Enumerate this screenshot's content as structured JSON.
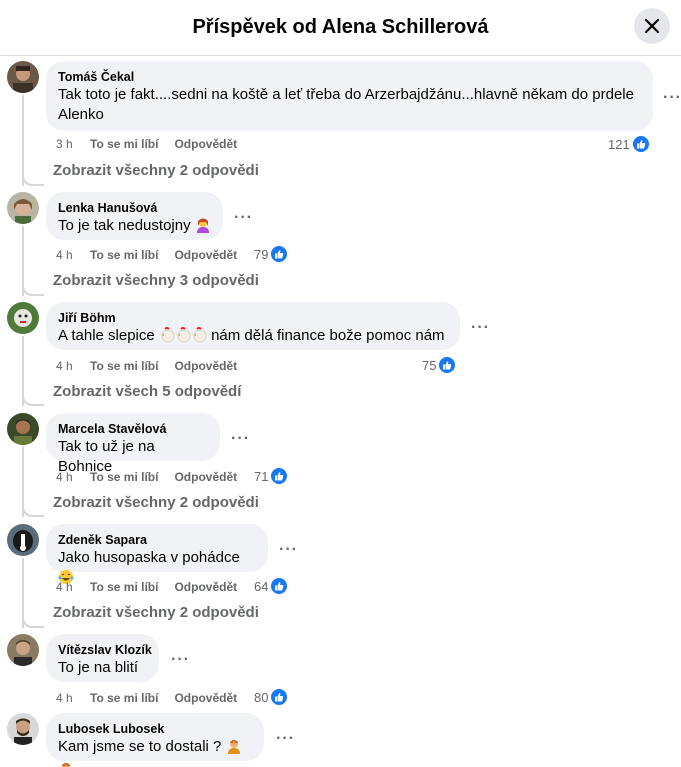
{
  "header": {
    "title": "Příspěvek od Alena Schillerová"
  },
  "action_labels": {
    "like": "To se mi líbí",
    "reply": "Odpovědět"
  },
  "comments": [
    {
      "author": "Tomáš Čekal",
      "text_line1": "Tak toto je fakt....sedni na koště a leť třeba do Arzerbajdžánu...hlavně někam do prdele",
      "text_line2": "Alenko",
      "time": "3 h",
      "likes": "121",
      "view_replies": "Zobrazit všechny 2 odpovědi"
    },
    {
      "author": "Lenka Hanušová",
      "text": "To je tak nedustojny",
      "time": "4 h",
      "likes": "79",
      "view_replies": "Zobrazit všechny 3 odpovědi"
    },
    {
      "author": "Jiří Böhm",
      "text_before": "A tahle slepice",
      "text_after": "nám dělá finance bože pomoc nám",
      "time": "4 h",
      "likes": "75",
      "view_replies": "Zobrazit všech 5 odpovědí"
    },
    {
      "author": "Marcela Stavělová",
      "text": "Tak to už je na Bohnice",
      "time": "4 h",
      "likes": "71",
      "view_replies": "Zobrazit všechny 2 odpovědi"
    },
    {
      "author": "Zdeněk Sapara",
      "text": "Jako husopaska v pohádce",
      "time": "4 h",
      "likes": "64",
      "view_replies": "Zobrazit všechny 2 odpovědi"
    },
    {
      "author": "Vítězslav Klozík",
      "text": "To je na blití",
      "time": "4 h",
      "likes": "80"
    },
    {
      "author": "Lubosek Lubosek",
      "text": "Kam jsme se to dostali ?"
    }
  ],
  "colors": {
    "accent": "#1877f2",
    "bubble": "#f0f2f5",
    "muted": "#65676b"
  }
}
